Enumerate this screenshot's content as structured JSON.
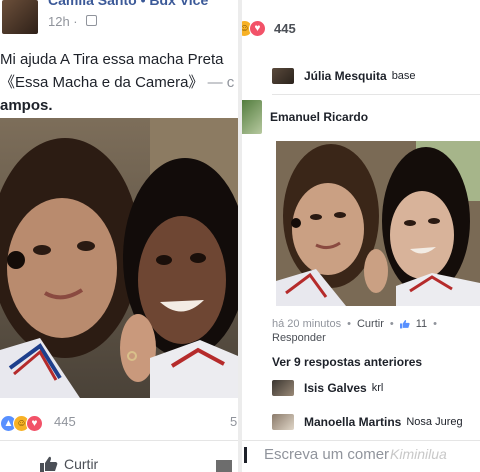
{
  "left_post": {
    "author": "Camila Santo • Bdx Vice",
    "time": "12h ·",
    "caption_line1": "Mi ajuda A Tira essa macha Preta",
    "caption_line2": "《Essa Macha e da Camera》",
    "caption_tag": "— c",
    "caption_line3": "ampos.",
    "reaction_count": "445",
    "side_number": "5",
    "like_label": "Curtir"
  },
  "right_post": {
    "reaction_count": "445",
    "comments": [
      {
        "name": "Júlia Mesquita",
        "text": "base"
      },
      {
        "name": "Emanuel Ricardo",
        "text": ""
      }
    ],
    "reply_meta": {
      "time": "há 20 minutos",
      "like_label": "Curtir",
      "like_count": "11",
      "reply_label": "Responder"
    },
    "more_replies": "Ver 9 respostas anteriores",
    "replies": [
      {
        "name": "Isis Galves",
        "text": "krl"
      },
      {
        "name": "Manoella Martins",
        "text": "Nosa Jureg"
      }
    ],
    "input_placeholder": "Escreva um comer",
    "watermark": "Kiminilua"
  },
  "colors": {
    "link_blue": "#3b5998",
    "meta_gray": "#90949c",
    "like_blue": "#5890ff",
    "love_red": "#f25268",
    "haha_yellow": "#f7b125"
  },
  "icons": [
    "globe-icon",
    "like-reaction-icon",
    "haha-reaction-icon",
    "love-reaction-icon",
    "thumbs-up-icon"
  ]
}
